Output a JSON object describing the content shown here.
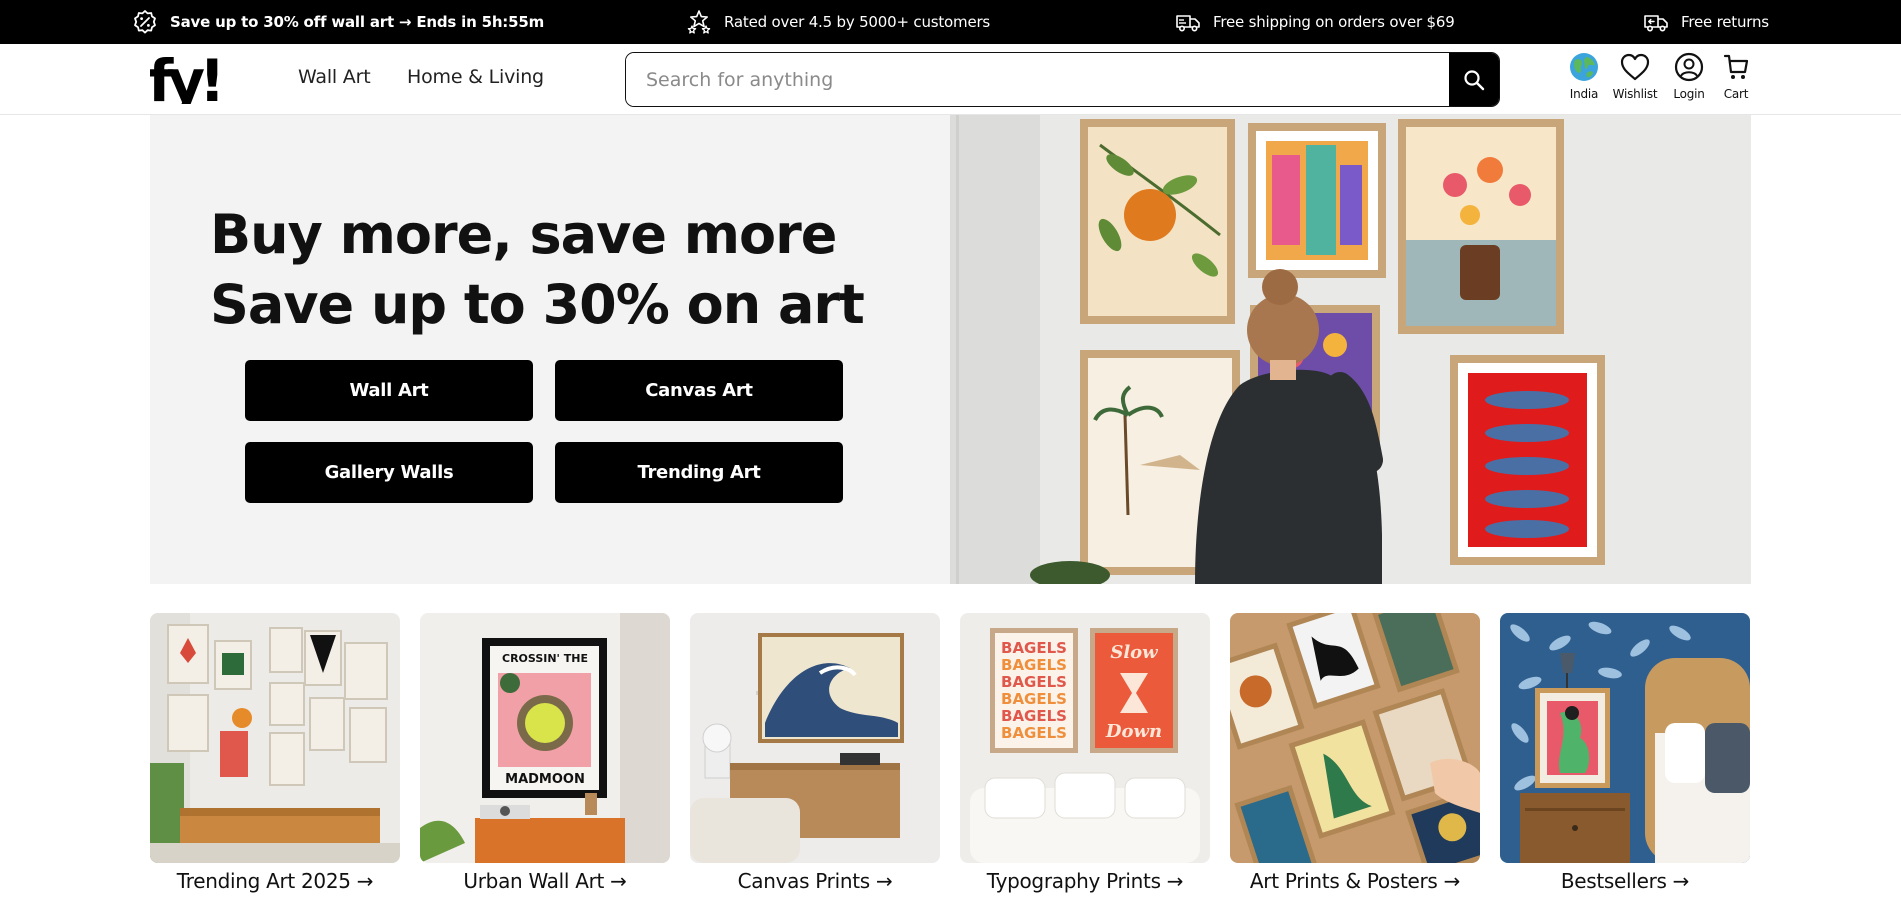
{
  "announcement": {
    "sale": "Save up to 30% off wall art → Ends in 5h:55m",
    "rating": "Rated over 4.5 by 5000+ customers",
    "shipping": "Free shipping on orders over $69",
    "returns": "Free returns",
    "icons": [
      "percent-badge-icon",
      "stars-icon",
      "truck-icon",
      "return-truck-icon"
    ]
  },
  "header": {
    "logo": "fy!",
    "nav": {
      "wall_art": "Wall Art",
      "home_living": "Home & Living"
    },
    "search": {
      "placeholder": "Search for anything",
      "value": ""
    },
    "actions": {
      "country": "India",
      "wishlist": "Wishlist",
      "login": "Login",
      "cart": "Cart"
    }
  },
  "hero": {
    "title_line1": "Buy more, save more",
    "title_line2": "Save up to 30% on art",
    "buttons": [
      "Wall Art",
      "Canvas Art",
      "Gallery Walls",
      "Trending Art"
    ]
  },
  "categories": [
    {
      "label": "Trending Art 2025 →"
    },
    {
      "label": "Urban Wall Art →"
    },
    {
      "label": "Canvas Prints →"
    },
    {
      "label": "Typography Prints →"
    },
    {
      "label": "Art Prints & Posters →"
    },
    {
      "label": "Bestsellers →"
    }
  ],
  "artwork_text": {
    "urban_poster_top": "CROSSIN' THE",
    "urban_poster_bottom": "MADMOON",
    "typography_word": "BAGELS",
    "typography_slow": "Slow",
    "typography_down": "Down"
  },
  "colors": {
    "topbar_bg": "#000000",
    "hero_panel": "#f3f3f3",
    "button_bg": "#000000",
    "button_text": "#ffffff"
  }
}
